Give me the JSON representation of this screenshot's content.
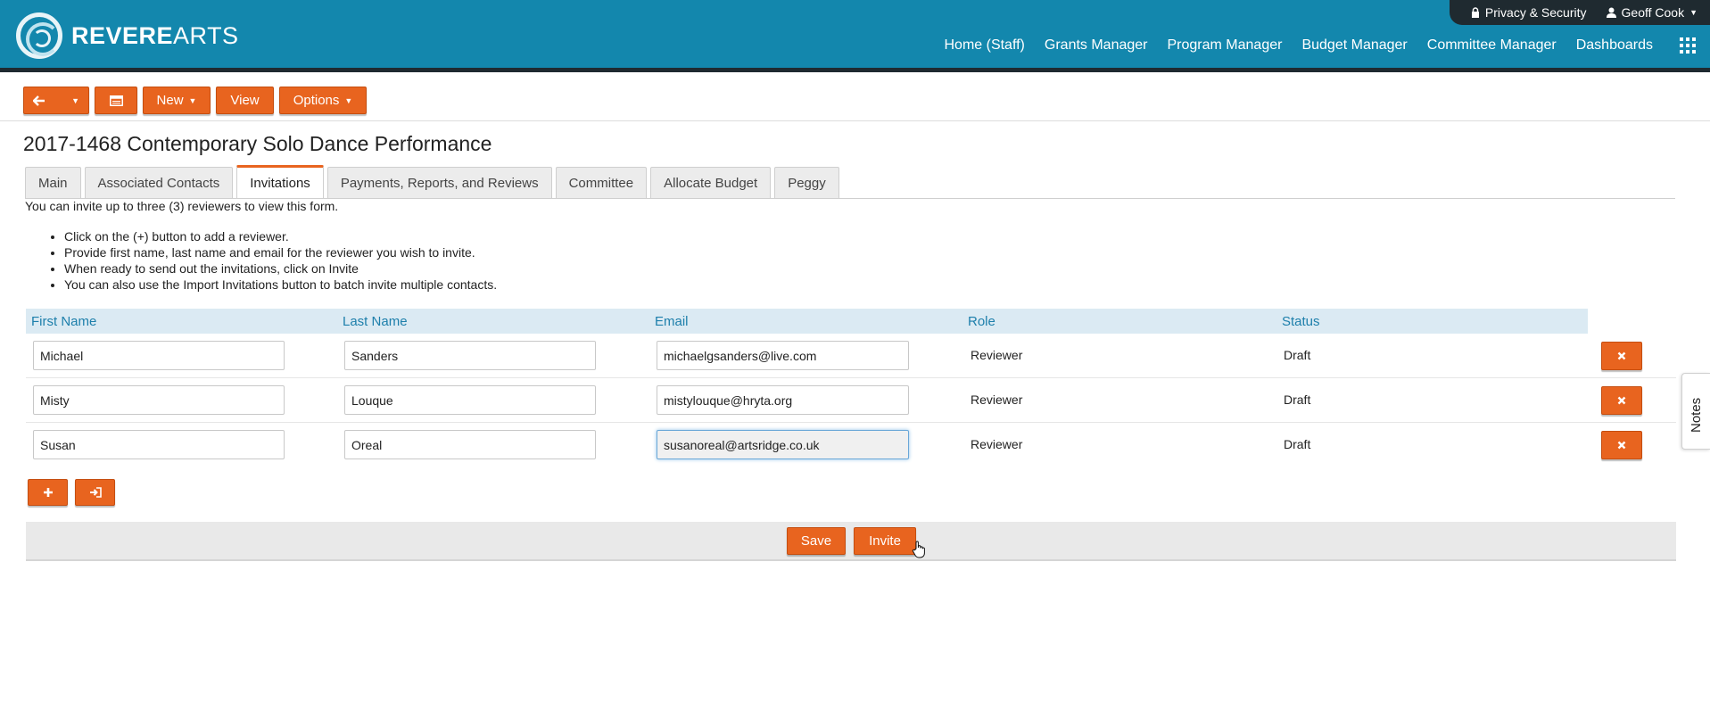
{
  "app": {
    "logo_bold": "REVERE",
    "logo_light": "ARTS",
    "privacy_label": "Privacy & Security",
    "user_label": "Geoff Cook",
    "nav": [
      "Home (Staff)",
      "Grants Manager",
      "Program Manager",
      "Budget Manager",
      "Committee Manager",
      "Dashboards"
    ]
  },
  "toolbar": {
    "back_icon": "arrow-left-icon",
    "calendar_icon": "calendar-icon",
    "new_label": "New",
    "view_label": "View",
    "options_label": "Options"
  },
  "page": {
    "title": "2017-1468 Contemporary Solo Dance Performance",
    "tabs": [
      "Main",
      "Associated Contacts",
      "Invitations",
      "Payments, Reports, and Reviews",
      "Committee",
      "Allocate Budget",
      "Peggy"
    ],
    "active_tab": "Invitations"
  },
  "instructions": {
    "intro": "You can invite up to three (3) reviewers to view this form.",
    "bullets": [
      "Click on the (+) button to add a reviewer.",
      "Provide first name, last name and email for the reviewer you wish to invite.",
      "When ready to send out the invitations, click on Invite",
      "You can also use the Import Invitations button to batch invite multiple contacts."
    ]
  },
  "table": {
    "headers": [
      "First Name",
      "Last Name",
      "Email",
      "Role",
      "Status"
    ],
    "rows": [
      {
        "first": "Michael",
        "last": "Sanders",
        "email": "michaelgsanders@live.com",
        "role": "Reviewer",
        "status": "Draft"
      },
      {
        "first": "Misty",
        "last": "Louque",
        "email": "mistylouque@hryta.org",
        "role": "Reviewer",
        "status": "Draft"
      },
      {
        "first": "Susan",
        "last": "Oreal",
        "email": "susanoreal@artsridge.co.uk",
        "role": "Reviewer",
        "status": "Draft"
      }
    ]
  },
  "actions": {
    "add_icon": "plus-icon",
    "import_icon": "import-icon",
    "save_label": "Save",
    "invite_label": "Invite"
  },
  "side": {
    "notes_label": "Notes"
  },
  "colors": {
    "header_bg": "#1387ad",
    "accent": "#e8641f",
    "table_header_bg": "#dbeaf3"
  }
}
